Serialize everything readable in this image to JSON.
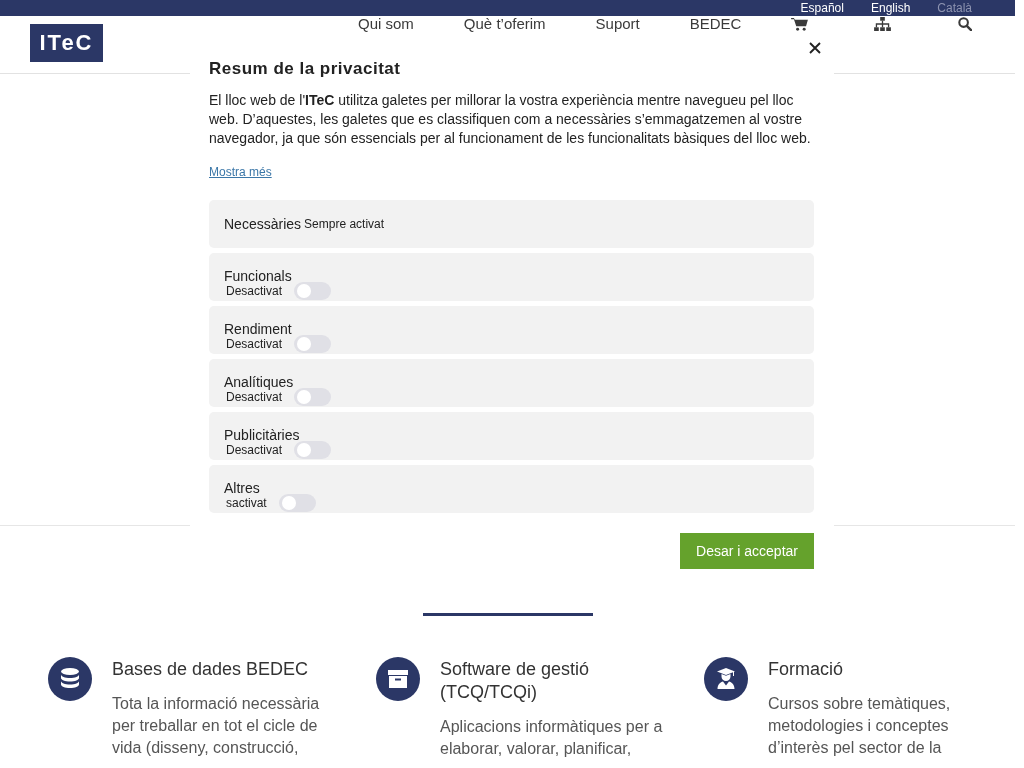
{
  "top_bar": {
    "languages": [
      {
        "label": "Español",
        "selected": false
      },
      {
        "label": "English",
        "selected": false
      },
      {
        "label": "Català",
        "selected": true
      }
    ]
  },
  "header": {
    "logo": "ITeC",
    "nav": [
      "Qui som",
      "Què t’oferim",
      "Suport",
      "BEDEC"
    ]
  },
  "section": {
    "services": [
      {
        "title": "Bases de dades BEDEC",
        "description": "Tota la informació necessària per treballar en tot el cicle de vida (disseny, construcció,"
      },
      {
        "title": "Software de gestió (TCQ/TCQi)",
        "description": "Aplicacions informàtiques per a elaborar, valorar, planificar,"
      },
      {
        "title": "Formació",
        "description": "Cursos sobre temàtiques, metodologies i conceptes d’interès pel sector de la"
      }
    ]
  },
  "privacy_dialog": {
    "title": "Resum de la privacitat",
    "body": "El lloc web de l'**ITeC** utilitza galetes per millorar la vostra experiència mentre navegueu pel lloc web. D’aquestes, les galetes que es classifiquen com a necessàries s’emmagatzemen al vostre navegador, ja que són essencials per al funcionament de les funcionalitats bàsiques del lloc web.",
    "more_link": "Mostra més",
    "categories": [
      {
        "kind": "always",
        "label": "Necessàries",
        "status": "Sempre activat"
      },
      {
        "kind": "toggle",
        "label": "Funcionals",
        "status": "Desactivat",
        "on": false
      },
      {
        "kind": "toggle",
        "label": "Rendiment",
        "status": "Desactivat",
        "on": false
      },
      {
        "kind": "toggle",
        "label": "Analítiques",
        "status": "Desactivat",
        "on": false
      },
      {
        "kind": "toggle",
        "label": "Publicitàries",
        "status": "Desactivat",
        "on": false
      },
      {
        "kind": "toggle",
        "label": "Altres",
        "status": "sactivat",
        "on": false
      }
    ],
    "save_button": "Desar i acceptar"
  }
}
